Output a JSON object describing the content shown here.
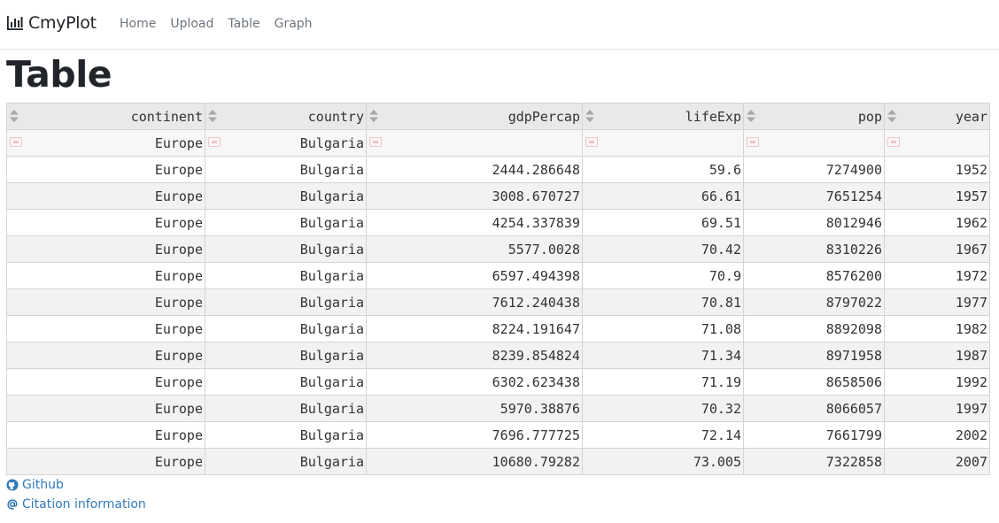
{
  "brand": {
    "name": "CmyPlot",
    "icon": "bar-chart-icon"
  },
  "nav": {
    "home": "Home",
    "upload": "Upload",
    "table": "Table",
    "graph": "Graph"
  },
  "page": {
    "title": "Table"
  },
  "table": {
    "columns": [
      "continent",
      "country",
      "gdpPercap",
      "lifeExp",
      "pop",
      "year"
    ],
    "filters": [
      "Europe",
      "Bulgaria",
      "",
      "",
      "",
      ""
    ],
    "rows": [
      [
        "Europe",
        "Bulgaria",
        "2444.286648",
        "59.6",
        "7274900",
        "1952"
      ],
      [
        "Europe",
        "Bulgaria",
        "3008.670727",
        "66.61",
        "7651254",
        "1957"
      ],
      [
        "Europe",
        "Bulgaria",
        "4254.337839",
        "69.51",
        "8012946",
        "1962"
      ],
      [
        "Europe",
        "Bulgaria",
        "5577.0028",
        "70.42",
        "8310226",
        "1967"
      ],
      [
        "Europe",
        "Bulgaria",
        "6597.494398",
        "70.9",
        "8576200",
        "1972"
      ],
      [
        "Europe",
        "Bulgaria",
        "7612.240438",
        "70.81",
        "8797022",
        "1977"
      ],
      [
        "Europe",
        "Bulgaria",
        "8224.191647",
        "71.08",
        "8892098",
        "1982"
      ],
      [
        "Europe",
        "Bulgaria",
        "8239.854824",
        "71.34",
        "8971958",
        "1987"
      ],
      [
        "Europe",
        "Bulgaria",
        "6302.623438",
        "71.19",
        "8658506",
        "1992"
      ],
      [
        "Europe",
        "Bulgaria",
        "5970.38876",
        "70.32",
        "8066057",
        "1997"
      ],
      [
        "Europe",
        "Bulgaria",
        "7696.777725",
        "72.14",
        "7661799",
        "2002"
      ],
      [
        "Europe",
        "Bulgaria",
        "10680.79282",
        "73.005",
        "7322858",
        "2007"
      ]
    ]
  },
  "footer": {
    "github": "Github",
    "citation": "Citation information"
  },
  "colors": {
    "link": "#337ab7",
    "nav_text": "#6c757d",
    "header_bg": "#e9e9e9",
    "filter_icon": "#f3c4c4"
  }
}
